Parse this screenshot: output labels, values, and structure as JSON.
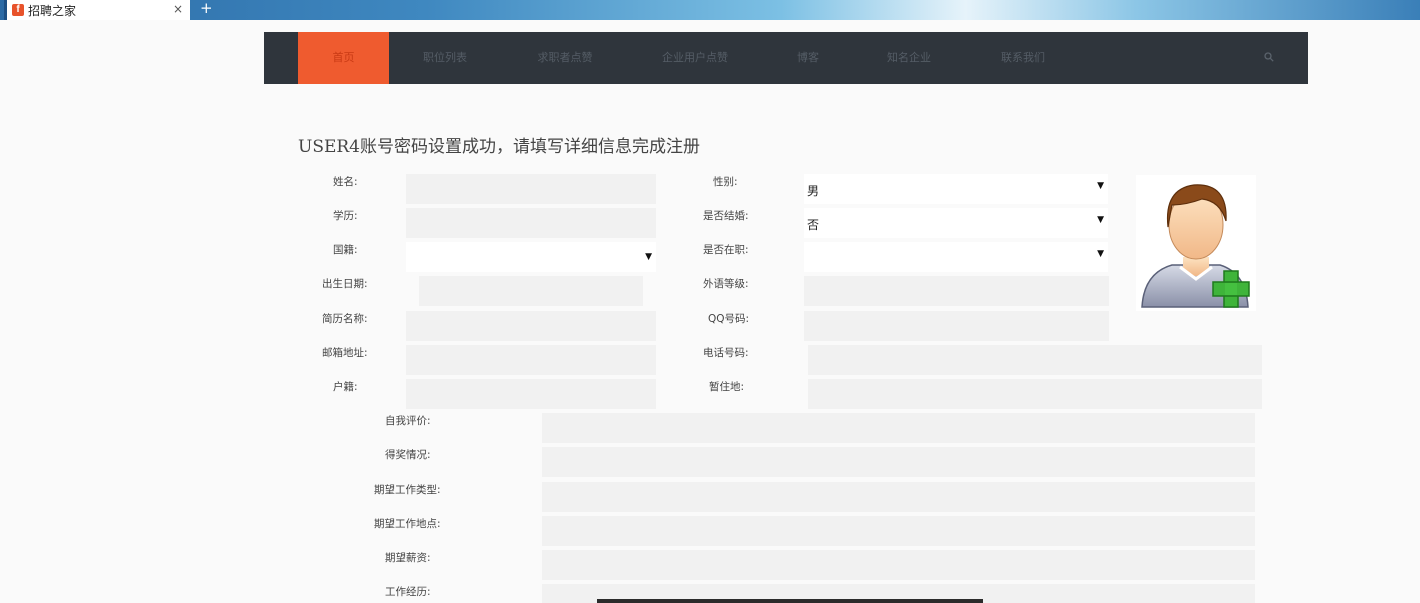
{
  "browser": {
    "tab_title": "招聘之家",
    "favicon_letter": "f",
    "close_glyph": "×",
    "new_tab_glyph": "+"
  },
  "nav": {
    "items": [
      "首页",
      "职位列表",
      "求职者点赞",
      "企业用户点赞",
      "博客",
      "知名企业",
      "联系我们"
    ],
    "active_index": 0,
    "active_color": "#ef5b2f",
    "bar_color": "#2f353c"
  },
  "heading": "USER4账号密码设置成功，请填写详细信息完成注册",
  "form": {
    "name_label": "姓名:",
    "gender_label": "性别:",
    "gender_value": "男",
    "education_label": "学历:",
    "married_label": "是否结婚:",
    "married_value": "否",
    "nationality_label": "国籍:",
    "nationality_value": "",
    "employed_label": "是否在职:",
    "employed_value": "",
    "birth_label": "出生日期:",
    "language_label": "外语等级:",
    "resume_label": "简历名称:",
    "qq_label": "QQ号码:",
    "email_label": "邮箱地址:",
    "phone_label": "电话号码:",
    "household_label": "户籍:",
    "residence_label": "暂住地:",
    "self_eval_label": "自我评价:",
    "awards_label": "得奖情况:",
    "job_type_label": "期望工作类型:",
    "job_location_label": "期望工作地点:",
    "salary_label": "期望薪资:",
    "experience_label": "工作经历:",
    "caret_glyph": "▼"
  },
  "avatar": {
    "icon": "user-add-icon"
  }
}
